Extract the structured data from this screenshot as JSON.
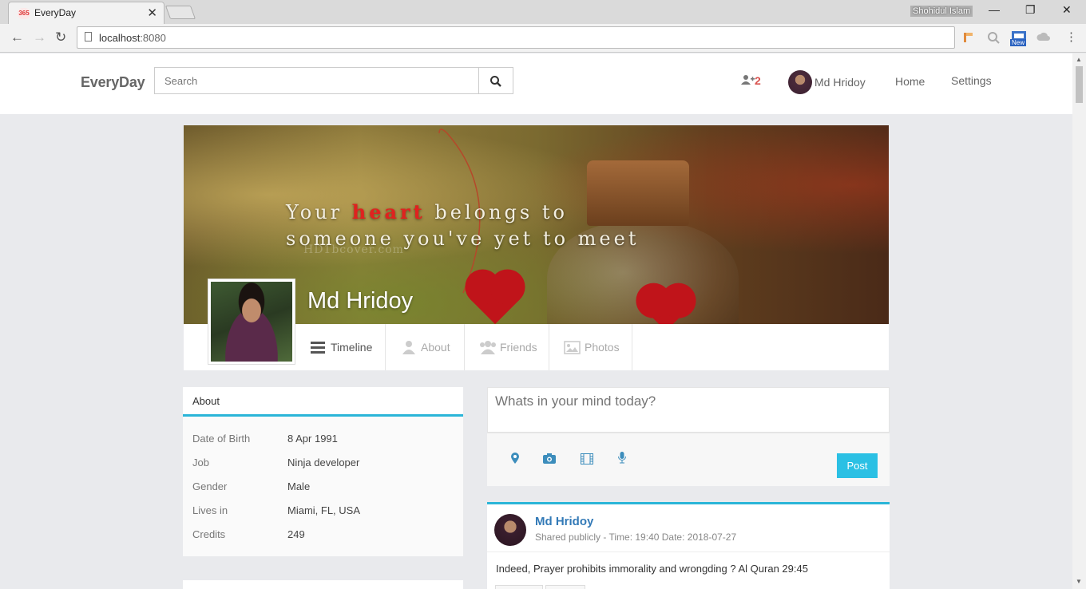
{
  "browser": {
    "tab_title": "EveryDay",
    "tab_close": "✕",
    "favicon_text": "365",
    "user_name": "Shohidul Islam",
    "url_host": "localhost",
    "url_port": ":8080",
    "ext_new_label": "New"
  },
  "navbar": {
    "brand": "EveryDay",
    "search_placeholder": "Search",
    "friend_request_count": "2",
    "user_name": "Md Hridoy",
    "links": [
      "Home",
      "Settings"
    ]
  },
  "cover": {
    "line1_a": "Your ",
    "line1_red": "heart",
    "line1_b": " belongs to",
    "line2": "someone you've yet to meet",
    "watermark": "HD1bcover.com",
    "profile_name": "Md Hridoy"
  },
  "profile_tabs": [
    "Timeline",
    "About",
    "Friends",
    "Photos"
  ],
  "about": {
    "heading": "About",
    "rows": [
      {
        "key": "Date of Birth",
        "value": "8 Apr 1991"
      },
      {
        "key": "Job",
        "value": "Ninja developer"
      },
      {
        "key": "Gender",
        "value": "Male"
      },
      {
        "key": "Lives in",
        "value": "Miami, FL, USA"
      },
      {
        "key": "Credits",
        "value": "249"
      }
    ]
  },
  "composer": {
    "placeholder": "Whats in your mind today?",
    "post_label": "Post"
  },
  "post": {
    "author": "Md Hridoy",
    "meta": "Shared publicly -  Time:  19:40   Date:  2018-07-27",
    "text": "Indeed, Prayer prohibits immorality and wrongding ? Al Quran 29:45"
  },
  "colors": {
    "accent": "#2bb5d8",
    "link": "#337ab7",
    "badge_red": "#d9534f",
    "post_button": "#2bc0e4"
  }
}
